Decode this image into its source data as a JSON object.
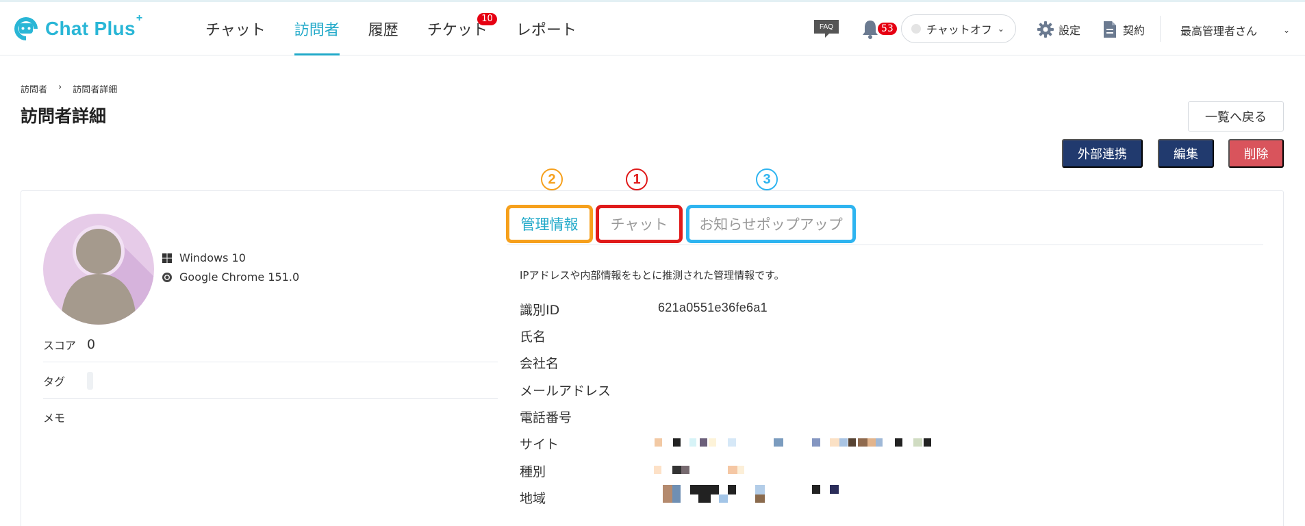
{
  "app": {
    "brand": "Chat Plus",
    "brand_sup": "+"
  },
  "nav": {
    "items": [
      {
        "label": "チャット"
      },
      {
        "label": "訪問者"
      },
      {
        "label": "履歴"
      },
      {
        "label": "チケット",
        "badge": "10"
      },
      {
        "label": "レポート"
      }
    ]
  },
  "header": {
    "faq_label": "FAQ",
    "notification_count": "53",
    "chat_status": "チャットオフ",
    "settings_label": "設定",
    "contract_label": "契約",
    "user_name": "最高管理者さん"
  },
  "breadcrumb": [
    "訪問者",
    "›",
    "訪問者詳細"
  ],
  "page": {
    "title": "訪問者詳細",
    "back_button": "一覧へ戻る",
    "external_button": "外部連携",
    "edit_button": "編集",
    "delete_button": "削除"
  },
  "visitor": {
    "os": "Windows 10",
    "browser": "Google Chrome 151.0",
    "score_label": "スコア",
    "score_value": "0",
    "tag_label": "タグ",
    "memo_label": "メモ"
  },
  "tabs": {
    "items": [
      {
        "label": "管理情報",
        "marker": "2",
        "marker_color": "#f6a01c",
        "active": true
      },
      {
        "label": "チャット",
        "marker": "1",
        "marker_color": "#e01a1a"
      },
      {
        "label": "お知らせポップアップ",
        "marker": "3",
        "marker_color": "#2eb4f0"
      }
    ]
  },
  "admin_info": {
    "description": "IPアドレスや内部情報をもとに推測された管理情報です。",
    "fields": [
      {
        "label": "識別ID",
        "value": "621a0551e36fe6a1"
      },
      {
        "label": "氏名",
        "value": ""
      },
      {
        "label": "会社名",
        "value": ""
      },
      {
        "label": "メールアドレス",
        "value": ""
      },
      {
        "label": "電話番号",
        "value": ""
      },
      {
        "label": "サイト",
        "value": ""
      },
      {
        "label": "種別",
        "value": ""
      },
      {
        "label": "地域",
        "value": ""
      }
    ]
  },
  "colors": {
    "accent": "#21a9c9",
    "navy": "#213a6e",
    "danger": "#d9545c"
  }
}
